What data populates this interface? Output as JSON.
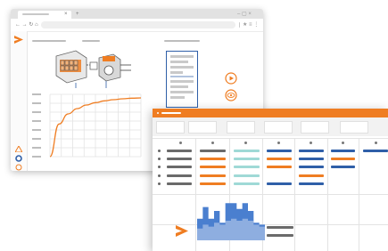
{
  "browser": {
    "tab_close": "×",
    "new_tab": "+",
    "window_controls": "– ▢ ×",
    "nav_buttons": "← → ↻ ⌂",
    "address_actions": "★ ≡ ⋮"
  },
  "colors": {
    "accent": "#ef7d22",
    "blue": "#2f5fa8",
    "teal": "#9fd9d6",
    "dark": "#6a6a6a",
    "chart_blue": "#4a7fcf"
  },
  "icons": {
    "logo": "orange-triangle-logo",
    "play": "play-icon",
    "eye": "eye-icon",
    "sidebar": [
      "alert-icon",
      "settings-icon",
      "info-icon"
    ]
  },
  "chart_data": [
    {
      "type": "line",
      "title": "",
      "xlabel": "",
      "ylabel": "",
      "x": [
        0,
        1,
        2,
        3,
        4,
        5,
        6,
        7,
        8,
        9,
        10
      ],
      "y": [
        0,
        0.55,
        0.72,
        0.81,
        0.87,
        0.91,
        0.94,
        0.96,
        0.975,
        0.985,
        0.99
      ],
      "ylim": [
        0,
        1.05
      ],
      "grid": true
    },
    {
      "type": "area",
      "title": "",
      "xlabel": "",
      "ylabel": "",
      "x": [
        0,
        1,
        2,
        3,
        4,
        5,
        6,
        7,
        8,
        9,
        10,
        11
      ],
      "series": [
        {
          "values": [
            0.55,
            0.85,
            0.55,
            0.75,
            0.45,
            0.95,
            0.95,
            0.8,
            0.95,
            0.75,
            0.45,
            0.4
          ]
        },
        {
          "values": [
            0.3,
            0.4,
            0.35,
            0.45,
            0.4,
            0.5,
            0.55,
            0.5,
            0.55,
            0.5,
            0.4,
            0.35
          ]
        }
      ],
      "ylim": [
        0,
        1
      ],
      "grid": false
    }
  ]
}
